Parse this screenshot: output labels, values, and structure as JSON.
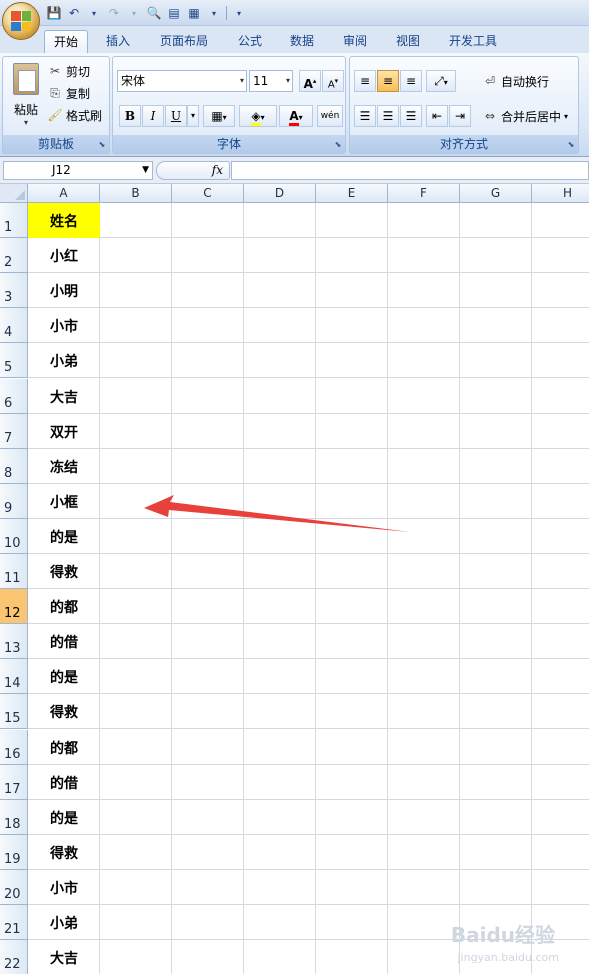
{
  "tabs": [
    "开始",
    "插入",
    "页面布局",
    "公式",
    "数据",
    "审阅",
    "视图",
    "开发工具"
  ],
  "active_tab": "开始",
  "clipboard": {
    "paste": "粘贴",
    "cut": "剪切",
    "copy": "复制",
    "format_painter": "格式刷",
    "group_label": "剪贴板"
  },
  "font": {
    "name": "宋体",
    "size": "11",
    "bold": "B",
    "italic": "I",
    "underline": "U",
    "grow": "A",
    "shrink": "A",
    "font_color_letter": "A",
    "phonetic": "wén",
    "group_label": "字体",
    "fill_color": "#ffff00",
    "font_color": "#ff0000"
  },
  "alignment": {
    "wrap_text": "自动换行",
    "merge_center": "合并后居中",
    "group_label": "对齐方式"
  },
  "name_box": "J12",
  "fx_label": "fx",
  "columns": [
    "A",
    "B",
    "C",
    "D",
    "E",
    "F",
    "G",
    "H"
  ],
  "selected_row": 12,
  "rows": [
    {
      "num": "1",
      "a": "姓名"
    },
    {
      "num": "2",
      "a": "小红"
    },
    {
      "num": "3",
      "a": "小明"
    },
    {
      "num": "4",
      "a": "小市"
    },
    {
      "num": "5",
      "a": "小弟"
    },
    {
      "num": "6",
      "a": "大吉"
    },
    {
      "num": "7",
      "a": "双开"
    },
    {
      "num": "8",
      "a": "冻结"
    },
    {
      "num": "9",
      "a": "小框"
    },
    {
      "num": "10",
      "a": "的是"
    },
    {
      "num": "11",
      "a": "得救"
    },
    {
      "num": "12",
      "a": "的都"
    },
    {
      "num": "13",
      "a": "的借"
    },
    {
      "num": "14",
      "a": "的是"
    },
    {
      "num": "15",
      "a": "得救"
    },
    {
      "num": "16",
      "a": "的都"
    },
    {
      "num": "17",
      "a": "的借"
    },
    {
      "num": "18",
      "a": "的是"
    },
    {
      "num": "19",
      "a": "得救"
    },
    {
      "num": "20",
      "a": "小市"
    },
    {
      "num": "21",
      "a": "小弟"
    },
    {
      "num": "22",
      "a": "大吉"
    }
  ],
  "header_cell_color": "#ffff00",
  "annotation_color": "#e8403a",
  "watermark": "Baidu经验",
  "watermark_sub": "jingyan.baidu.com"
}
